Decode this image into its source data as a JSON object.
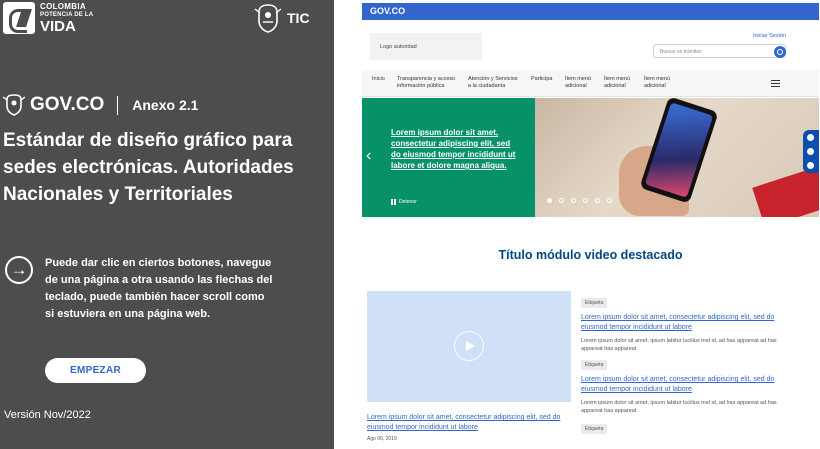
{
  "brand": {
    "line1": "COLOMBIA",
    "line2": "POTENCIA DE LA",
    "line3": "VIDA",
    "tic": "TIC"
  },
  "intro": {
    "gov_logo": "GOV.CO",
    "annex": "Anexo 2.1",
    "title": "Estándar de diseño gráfico para sedes electrónicas. Autoridades Nacionales y Territoriales",
    "help": "Puede dar clic en ciertos botones, navegue de una página a otra usando las flechas del teclado, puede también hacer scroll como si estuviera en una página web.",
    "start_label": "EMPEZAR",
    "version": "Versión Nov/2022"
  },
  "mockup": {
    "topbar_logo": "GOV.CO",
    "logo_label": "Logo autoridad",
    "login": "Iniciar Sesión",
    "search_placeholder": "Buscar en trámites",
    "nav": [
      {
        "line1": "Inicio",
        "line2": ""
      },
      {
        "line1": "Transparencia y acceso",
        "line2": "información pública"
      },
      {
        "line1": "Atención y Servicios",
        "line2": "a la ciudadanía"
      },
      {
        "line1": "Participa",
        "line2": ""
      },
      {
        "line1": "Ítem menú",
        "line2": "adicional"
      },
      {
        "line1": "Ítem menú",
        "line2": "adicional"
      },
      {
        "line1": "Ítem menú",
        "line2": "adicional"
      }
    ],
    "hero_text": "Lorem ipsum dolor sit amet, consectetur adipiscing elit, sed do eiusmod tempor incididunt ut labore et dolore magna aliqua.",
    "pause_label": "Detener",
    "section_title": "Título módulo video destacado",
    "video_caption": "Lorem ipsum dolor sit amet, consectetur adipiscing elit, sed do eiusmod tempor incididunt ut labore",
    "video_date": "Ago 06, 2019",
    "cards": [
      {
        "tag": "Etiqueta",
        "title": "Lorem ipsum dolor sit amet, consectetur adipiscing elit, sed do eiusmod tempor incididunt ut labore",
        "body": "Lorem ipsum dolor sit amet, ipsum labitur lucilius mel id, ad has appareat ad has appareat has appareat"
      },
      {
        "tag": "Etiqueta",
        "title": "Lorem ipsum dolor sit amet, consectetur adipiscing elit, sed do eiusmod tempor incididunt ut labore",
        "body": "Lorem ipsum dolor sit amet, ipsum labitur lucilius mel id, ad has appareat ad has appareat has appareat"
      },
      {
        "tag": "Etiqueta",
        "title": "",
        "body": ""
      }
    ]
  }
}
